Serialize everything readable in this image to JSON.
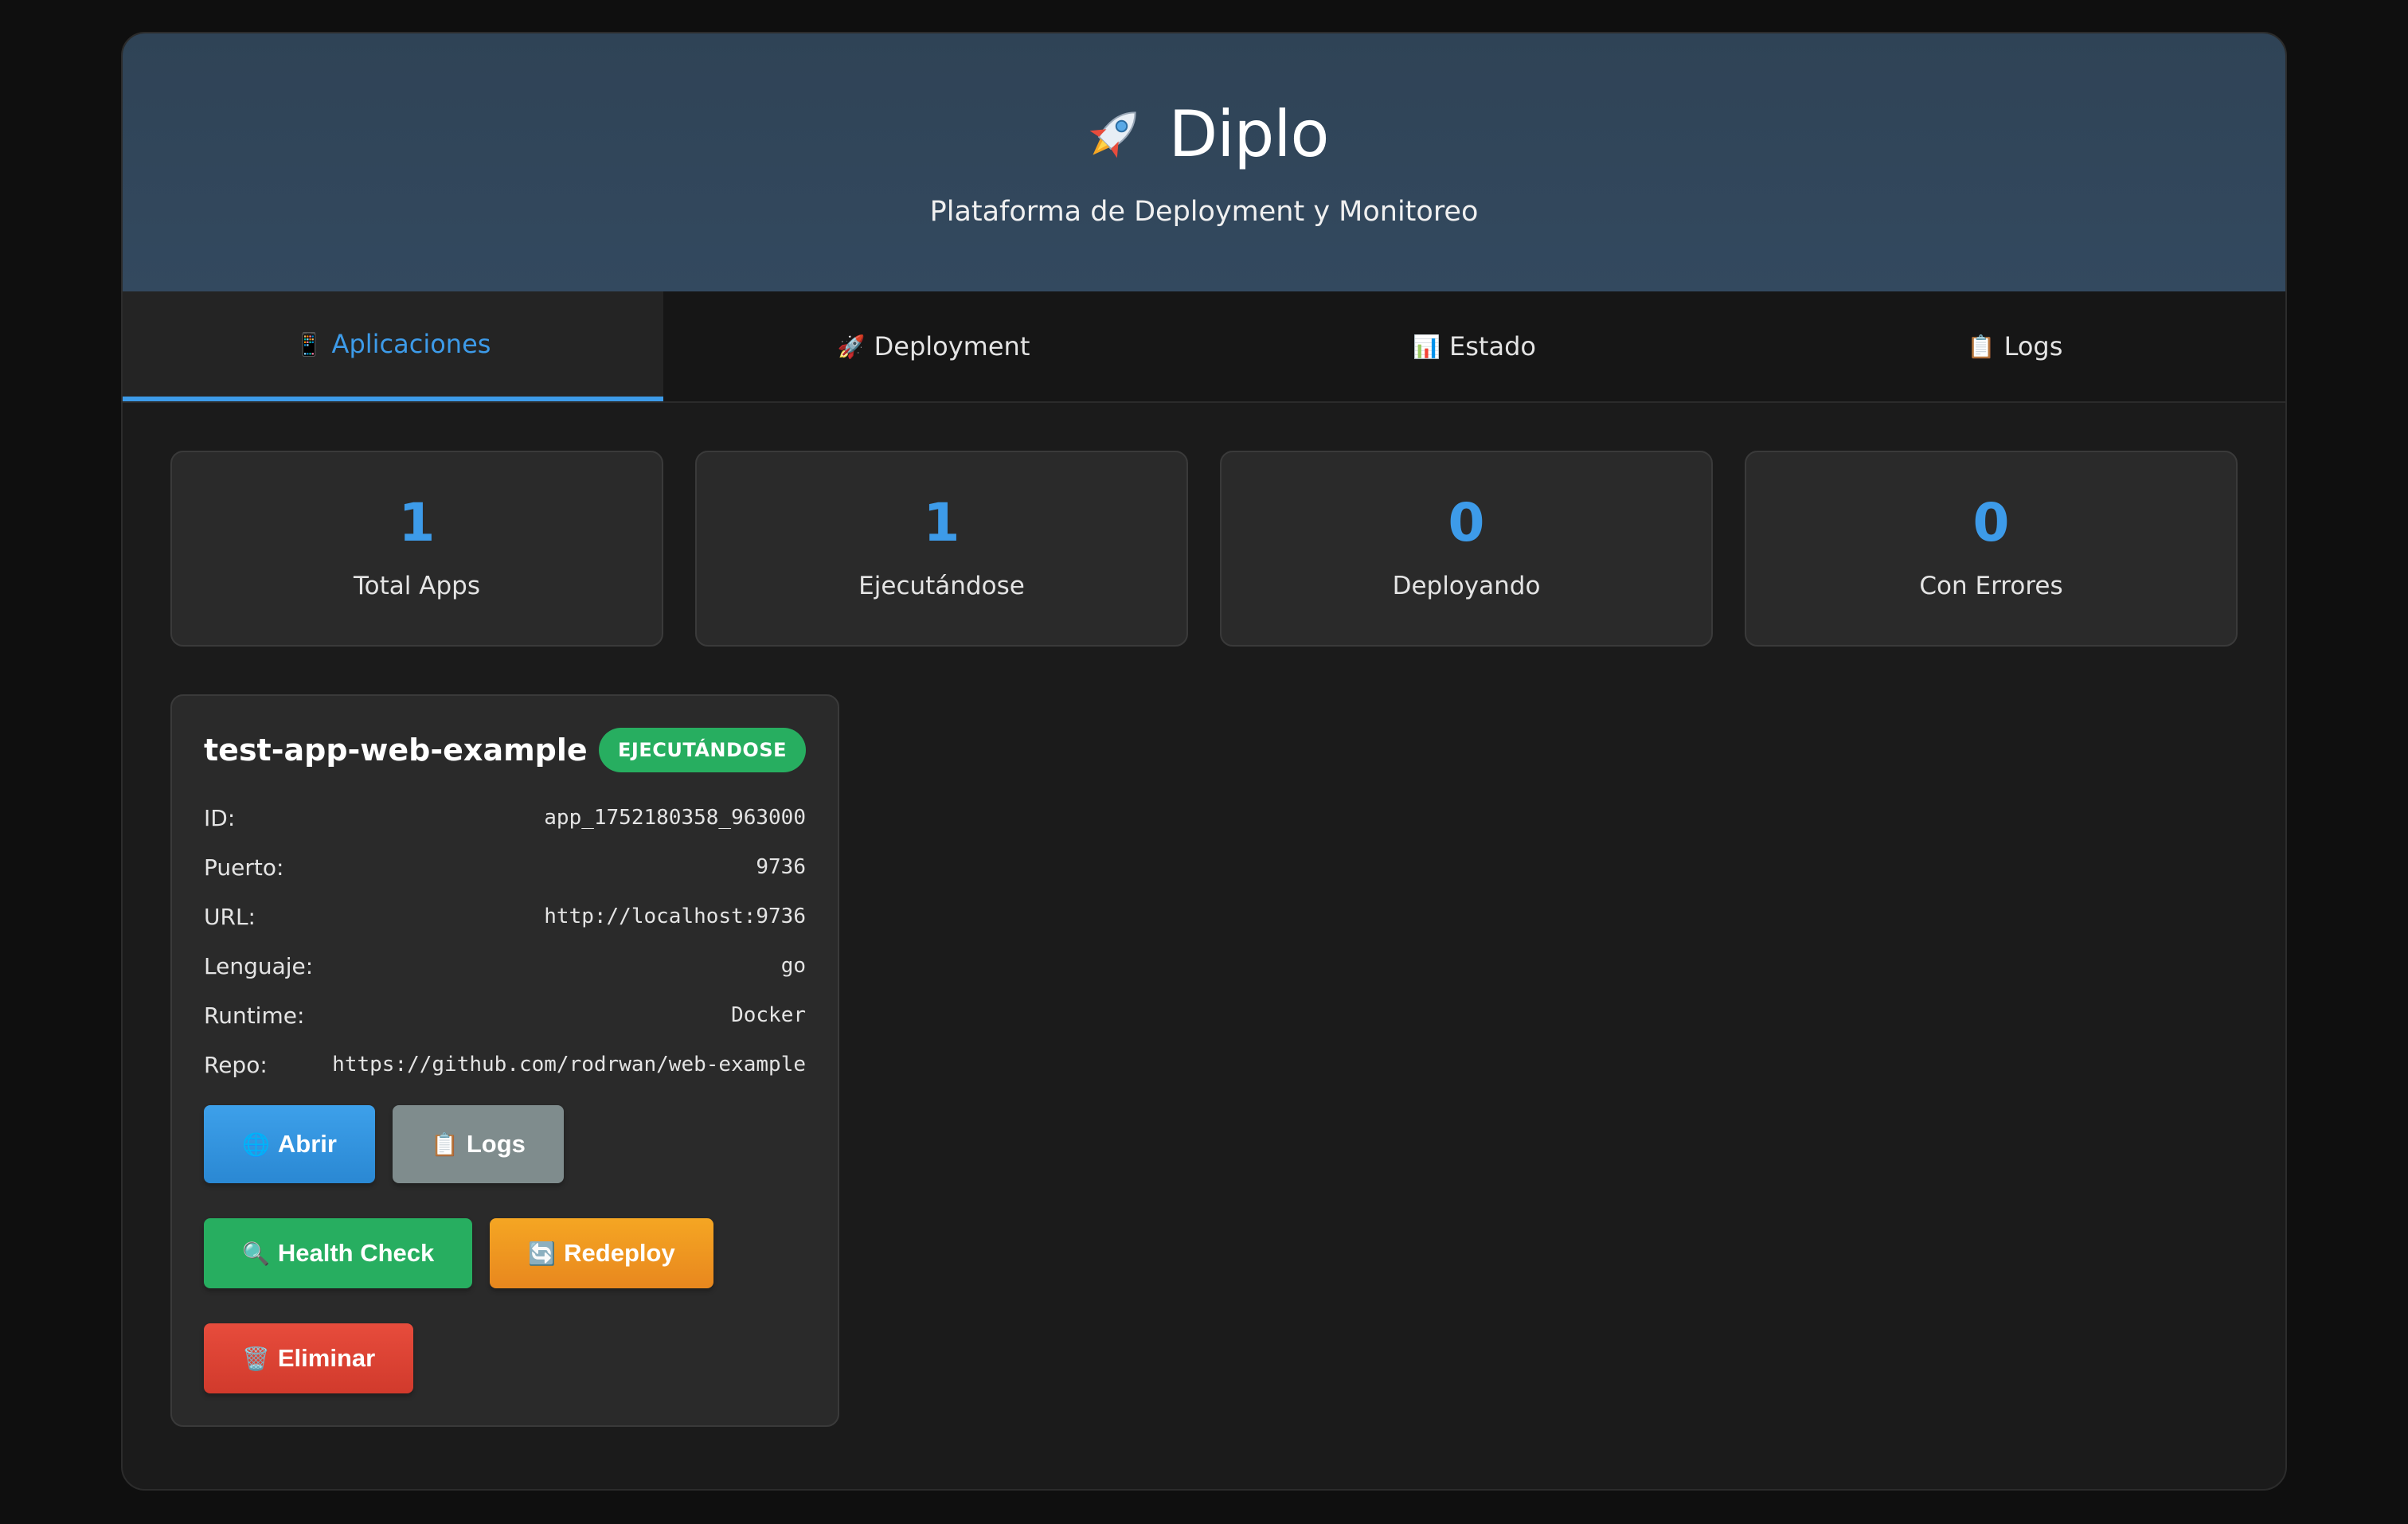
{
  "header": {
    "title": "Diplo",
    "logo_icon": "rocket-icon",
    "subtitle": "Plataforma de Deployment y Monitoreo"
  },
  "tabs": [
    {
      "label": "Aplicaciones",
      "icon": "mobile-phone-icon",
      "glyph": "📱",
      "active": true
    },
    {
      "label": "Deployment",
      "icon": "rocket-icon",
      "glyph": "🚀",
      "active": false
    },
    {
      "label": "Estado",
      "icon": "bar-chart-icon",
      "glyph": "📊",
      "active": false
    },
    {
      "label": "Logs",
      "icon": "clipboard-icon",
      "glyph": "📋",
      "active": false
    }
  ],
  "stats": [
    {
      "value": "1",
      "label": "Total Apps"
    },
    {
      "value": "1",
      "label": "Ejecutándose"
    },
    {
      "value": "0",
      "label": "Deployando"
    },
    {
      "value": "0",
      "label": "Con Errores"
    }
  ],
  "app": {
    "name": "test-app-web-example",
    "status": "EJECUTÁNDOSE",
    "status_color": "#27ae60",
    "fields": {
      "id": {
        "label": "ID:",
        "value": "app_1752180358_963000"
      },
      "port": {
        "label": "Puerto:",
        "value": "9736"
      },
      "url": {
        "label": "URL:",
        "value": "http://localhost:9736"
      },
      "language": {
        "label": "Lenguaje:",
        "value": "go"
      },
      "runtime": {
        "label": "Runtime:",
        "value": "Docker"
      },
      "repo": {
        "label": "Repo:",
        "value": "https://github.com/rodrwan/web-example"
      }
    },
    "buttons": {
      "open": {
        "label": "Abrir",
        "icon": "globe-icon",
        "glyph": "🌐"
      },
      "logs": {
        "label": "Logs",
        "icon": "clipboard-icon",
        "glyph": "📋"
      },
      "health": {
        "label": "Health Check",
        "icon": "magnifier-icon",
        "glyph": "🔍"
      },
      "redeploy": {
        "label": "Redeploy",
        "icon": "refresh-icon",
        "glyph": "🔄"
      },
      "delete": {
        "label": "Eliminar",
        "icon": "trash-icon",
        "glyph": "🗑️"
      }
    }
  },
  "colors": {
    "accent": "#3d9be9",
    "background": "#1b1b1b",
    "header": "#2f4356",
    "success": "#27ae60",
    "warning": "#f5a623",
    "danger": "#e74c3c",
    "neutral": "#7f8c8d"
  }
}
